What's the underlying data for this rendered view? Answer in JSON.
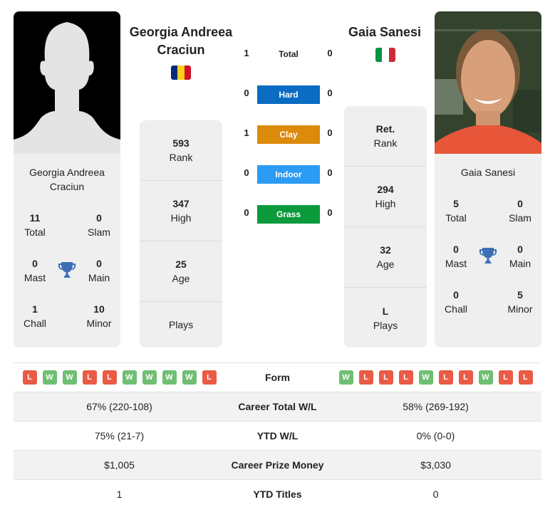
{
  "player1": {
    "name": "Georgia Andreea Craciun",
    "name_line1": "Georgia Andreea",
    "name_line2": "Craciun",
    "flag_colors": [
      "#002B7F",
      "#FCD116",
      "#CE1126"
    ],
    "photo": "silhouette-placeholder",
    "titles": {
      "total": {
        "value": "11",
        "label": "Total"
      },
      "slam": {
        "value": "0",
        "label": "Slam"
      },
      "mast": {
        "value": "0",
        "label": "Mast"
      },
      "main": {
        "value": "0",
        "label": "Main"
      },
      "chall": {
        "value": "1",
        "label": "Chall"
      },
      "minor": {
        "value": "10",
        "label": "Minor"
      }
    },
    "info": {
      "rank": {
        "value": "593",
        "label": "Rank"
      },
      "high": {
        "value": "347",
        "label": "High"
      },
      "age": {
        "value": "25",
        "label": "Age"
      },
      "plays": {
        "value": "",
        "label": "Plays"
      }
    },
    "form": [
      "L",
      "W",
      "W",
      "L",
      "L",
      "W",
      "W",
      "W",
      "W",
      "L"
    ]
  },
  "player2": {
    "name": "Gaia Sanesi",
    "flag_colors": [
      "#009246",
      "#FFFFFF",
      "#CE2B37"
    ],
    "photo": "player-photo",
    "titles": {
      "total": {
        "value": "5",
        "label": "Total"
      },
      "slam": {
        "value": "0",
        "label": "Slam"
      },
      "mast": {
        "value": "0",
        "label": "Mast"
      },
      "main": {
        "value": "0",
        "label": "Main"
      },
      "chall": {
        "value": "0",
        "label": "Chall"
      },
      "minor": {
        "value": "5",
        "label": "Minor"
      }
    },
    "info": {
      "rank": {
        "value": "Ret.",
        "label": "Rank"
      },
      "high": {
        "value": "294",
        "label": "High"
      },
      "age": {
        "value": "32",
        "label": "Age"
      },
      "plays": {
        "value": "L",
        "label": "Plays"
      }
    },
    "form": [
      "W",
      "L",
      "L",
      "L",
      "W",
      "L",
      "L",
      "W",
      "L",
      "L"
    ]
  },
  "h2h": {
    "total": {
      "label": "Total",
      "p1": "1",
      "p2": "0"
    },
    "surfaces": [
      {
        "label": "Hard",
        "p1": "0",
        "p2": "0",
        "color": "#0A6CC2"
      },
      {
        "label": "Clay",
        "p1": "1",
        "p2": "0",
        "color": "#DC8A0A"
      },
      {
        "label": "Indoor",
        "p1": "0",
        "p2": "0",
        "color": "#2B9BF4"
      },
      {
        "label": "Grass",
        "p1": "0",
        "p2": "0",
        "color": "#0A9A3C"
      }
    ]
  },
  "comparison": {
    "form_label": "Form",
    "rows": [
      {
        "label": "Career Total W/L",
        "p1": "67% (220-108)",
        "p2": "58% (269-192)"
      },
      {
        "label": "YTD W/L",
        "p1": "75% (21-7)",
        "p2": "0% (0-0)"
      },
      {
        "label": "Career Prize Money",
        "p1": "$1,005",
        "p2": "$3,030"
      },
      {
        "label": "YTD Titles",
        "p1": "1",
        "p2": "0"
      }
    ]
  }
}
